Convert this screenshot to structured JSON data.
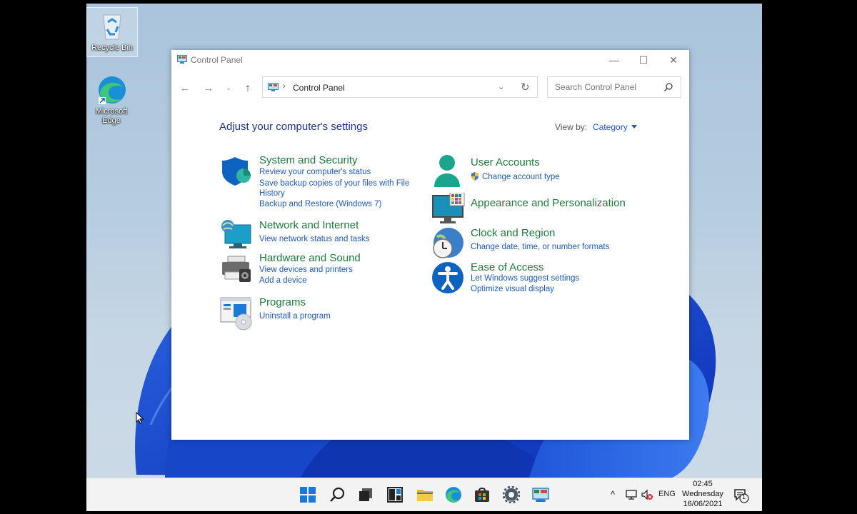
{
  "desktop": {
    "icons": [
      {
        "label": "Recycle Bin"
      },
      {
        "label": "Microsoft Edge"
      }
    ]
  },
  "window": {
    "title": "Control Panel",
    "controls": {
      "minimize": "—",
      "maximize": "☐",
      "close": "✕"
    },
    "nav": {
      "back": "←",
      "forward": "→",
      "recent": "⌄",
      "up": "↑"
    },
    "address": {
      "separator": "›",
      "location": "Control Panel",
      "dropdown": "⌄",
      "refresh": "↻"
    },
    "search": {
      "placeholder": "Search Control Panel"
    },
    "heading": "Adjust your computer's settings",
    "view_by": {
      "label": "View by:",
      "value": "Category"
    },
    "categories": [
      {
        "title": "System and Security",
        "icon": "shield-icon",
        "links": [
          "Review your computer's status",
          "Save backup copies of your files with File",
          "History",
          "Backup and Restore (Windows 7)"
        ]
      },
      {
        "title": "Network and Internet",
        "icon": "network-globe-icon",
        "links": [
          "View network status and tasks"
        ]
      },
      {
        "title": "Hardware and Sound",
        "icon": "printer-speaker-icon",
        "links": [
          "View devices and printers",
          "Add a device"
        ]
      },
      {
        "title": "Programs",
        "icon": "programs-icon",
        "links": [
          "Uninstall a program"
        ]
      },
      {
        "title": "User Accounts",
        "icon": "user-icon",
        "links": [
          "Change account type"
        ]
      },
      {
        "title": "Appearance and Personalization",
        "icon": "monitor-palette-icon",
        "links": []
      },
      {
        "title": "Clock and Region",
        "icon": "clock-globe-icon",
        "links": [
          "Change date, time, or number formats"
        ]
      },
      {
        "title": "Ease of Access",
        "icon": "accessibility-icon",
        "links": [
          "Let Windows suggest settings",
          "Optimize visual display"
        ]
      }
    ]
  },
  "taskbar": {
    "apps": [
      "start-icon",
      "search-icon",
      "task-view-icon",
      "widgets-icon",
      "file-explorer-icon",
      "edge-icon",
      "store-icon",
      "settings-icon",
      "control-panel-icon"
    ],
    "tray": {
      "chevron": "^",
      "language": "ENG",
      "notification_count": "1"
    },
    "clock": {
      "time": "02:45",
      "day": "Wednesday",
      "date": "16/06/2021"
    }
  },
  "colors": {
    "category_title": "#1e7a3c",
    "link": "#1e5bb8",
    "heading": "#1e3287",
    "taskbar": "#f3f3f3"
  }
}
